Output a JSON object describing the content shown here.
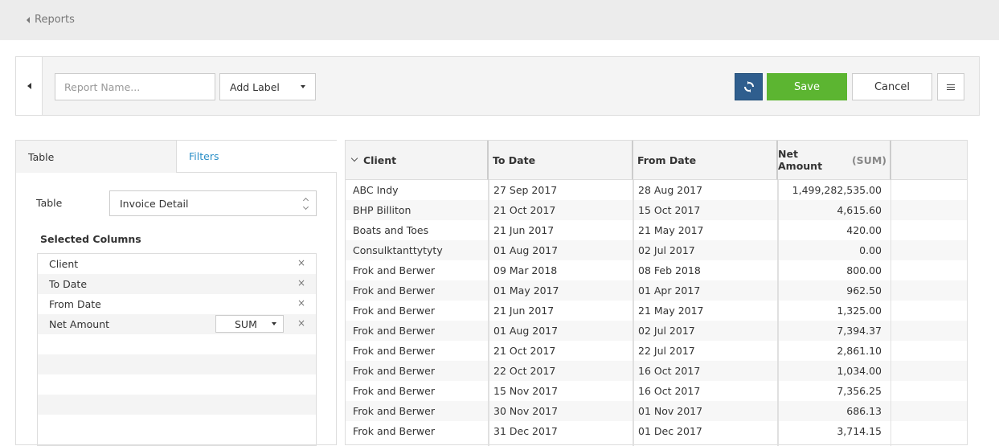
{
  "breadcrumb": {
    "back_label": "Reports"
  },
  "toolbar": {
    "report_name_placeholder": "Report Name...",
    "add_label": "Add Label",
    "save_label": "Save",
    "cancel_label": "Cancel"
  },
  "left_panel": {
    "tabs": [
      {
        "label": "Table"
      },
      {
        "label": "Filters"
      }
    ],
    "table_field_label": "Table",
    "table_value": "Invoice Detail",
    "selected_columns_title": "Selected Columns",
    "columns": [
      {
        "label": "Client"
      },
      {
        "label": "To Date"
      },
      {
        "label": "From Date"
      },
      {
        "label": "Net Amount",
        "aggregate": "SUM"
      }
    ],
    "remove_glyph": "×"
  },
  "grid": {
    "headers": {
      "client": "Client",
      "to_date": "To Date",
      "from_date": "From Date",
      "net_amount": "Net Amount",
      "net_amount_agg": "(SUM)"
    },
    "rows": [
      {
        "client": "ABC Indy",
        "to_date": "27 Sep 2017",
        "from_date": "28 Aug 2017",
        "net_amount": "1,499,282,535.00"
      },
      {
        "client": "BHP Billiton",
        "to_date": "21 Oct 2017",
        "from_date": "15 Oct 2017",
        "net_amount": "4,615.60"
      },
      {
        "client": "Boats and Toes",
        "to_date": "21 Jun 2017",
        "from_date": "21 May 2017",
        "net_amount": "420.00"
      },
      {
        "client": "Consulktanttytyty",
        "to_date": "01 Aug 2017",
        "from_date": "02 Jul 2017",
        "net_amount": "0.00"
      },
      {
        "client": "Frok and Berwer",
        "to_date": "09 Mar 2018",
        "from_date": "08 Feb 2018",
        "net_amount": "800.00"
      },
      {
        "client": "Frok and Berwer",
        "to_date": "01 May 2017",
        "from_date": "01 Apr 2017",
        "net_amount": "962.50"
      },
      {
        "client": "Frok and Berwer",
        "to_date": "21 Jun 2017",
        "from_date": "21 May 2017",
        "net_amount": "1,325.00"
      },
      {
        "client": "Frok and Berwer",
        "to_date": "01 Aug 2017",
        "from_date": "02 Jul 2017",
        "net_amount": "7,394.37"
      },
      {
        "client": "Frok and Berwer",
        "to_date": "21 Oct 2017",
        "from_date": "22 Jul 2017",
        "net_amount": "2,861.10"
      },
      {
        "client": "Frok and Berwer",
        "to_date": "22 Oct 2017",
        "from_date": "16 Oct 2017",
        "net_amount": "1,034.00"
      },
      {
        "client": "Frok and Berwer",
        "to_date": "15 Nov 2017",
        "from_date": "16 Oct 2017",
        "net_amount": "7,356.25"
      },
      {
        "client": "Frok and Berwer",
        "to_date": "30 Nov 2017",
        "from_date": "01 Nov 2017",
        "net_amount": "686.13"
      },
      {
        "client": "Frok and Berwer",
        "to_date": "31 Dec 2017",
        "from_date": "01 Dec 2017",
        "net_amount": "3,714.15"
      }
    ]
  },
  "colors": {
    "save": "#5cb531",
    "refresh": "#2f5e8e",
    "link": "#2a8fc7"
  },
  "icons": [
    "back-caret-icon",
    "collapse-icon",
    "dropdown-caret-icon",
    "refresh-icon",
    "menu-icon",
    "sort-icon",
    "remove-icon"
  ]
}
